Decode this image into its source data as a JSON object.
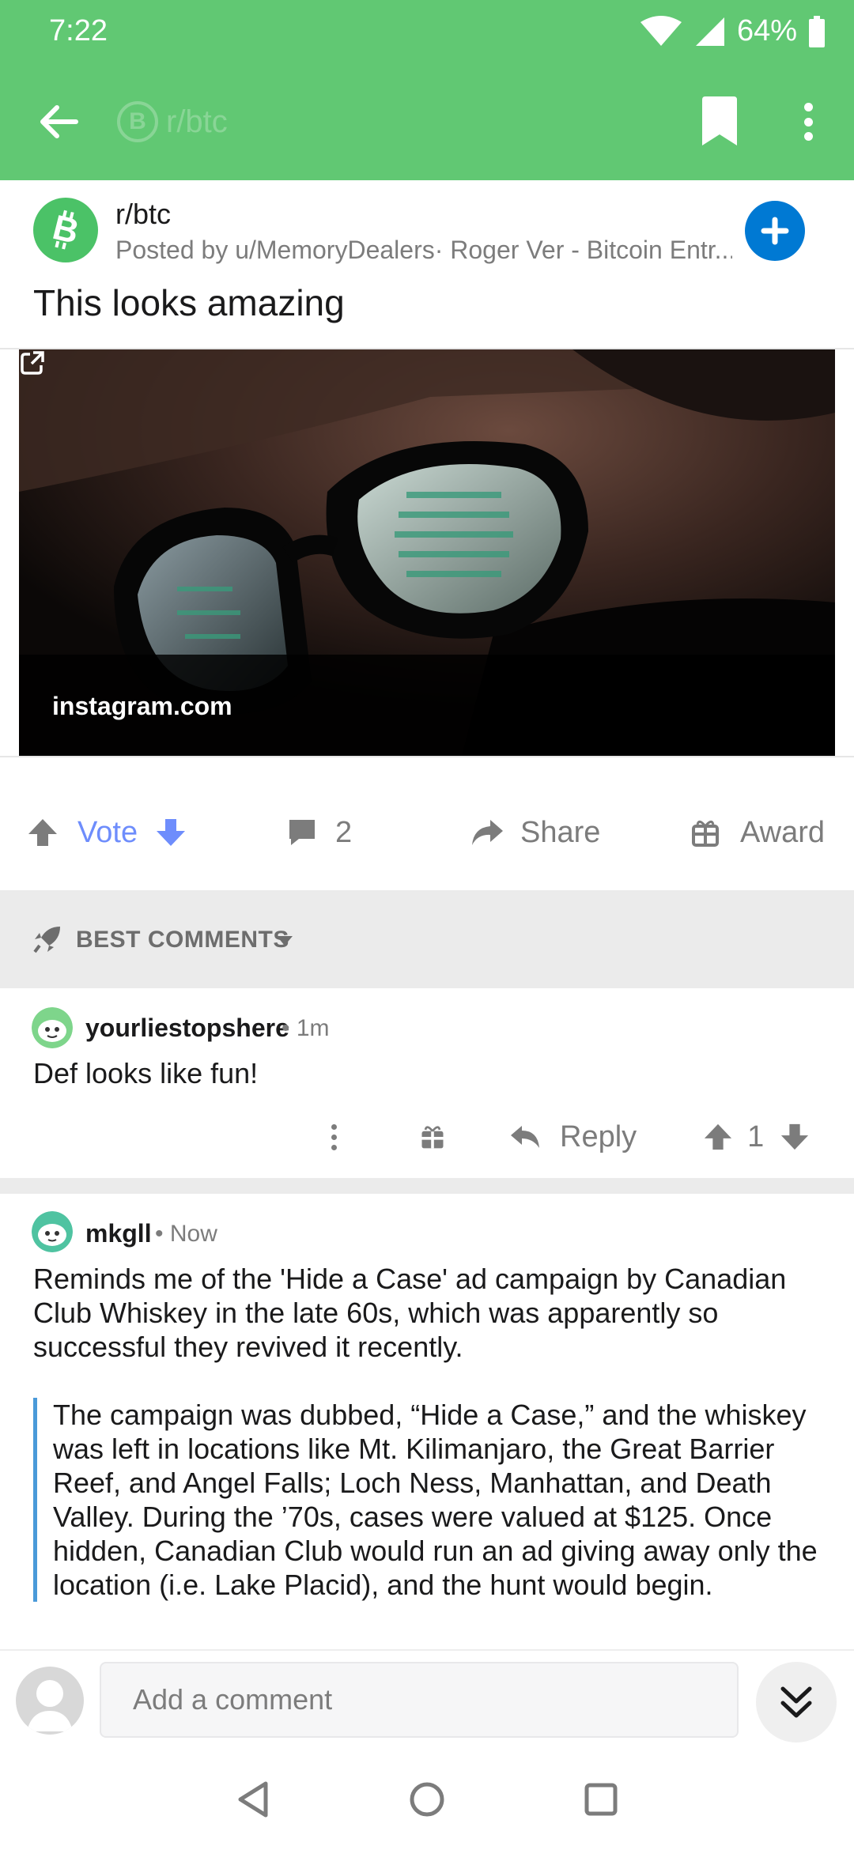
{
  "status": {
    "time": "7:22",
    "battery": "64%"
  },
  "toolbar": {
    "title": "r/btc"
  },
  "post": {
    "subreddit": "r/btc",
    "posted_by": "Posted by u/MemoryDealers· Roger Ver - Bitcoin Entr...",
    "title": "This looks amazing",
    "link_domain": "instagram.com"
  },
  "actions": {
    "vote_label": "Vote",
    "comment_count": "2",
    "share_label": "Share",
    "award_label": "Award"
  },
  "sort": {
    "label": "BEST COMMENTS"
  },
  "comments": [
    {
      "user": "yourliestopshere",
      "time": "• 1m",
      "body": "Def looks like fun!",
      "reply_label": "Reply",
      "score": "1"
    },
    {
      "user": "mkgll",
      "time": "• Now",
      "body": "Reminds me of the 'Hide a Case' ad campaign by Canadian Club Whiskey in the late 60s, which was apparently so successful they revived it recently.",
      "quote": "The campaign was dubbed, “Hide a Case,” and the whiskey was left in locations like Mt. Kilimanjaro, the Great Barrier Reef, and Angel Falls; Loch Ness, Manhattan, and Death Valley. During the ’70s, cases were valued at $125. Once hidden, Canadian Club would run an ad giving away only the location (i.e. Lake Placid), and the hunt would begin."
    }
  ],
  "composer": {
    "placeholder": "Add a comment"
  },
  "colors": {
    "header": "#61c873",
    "subreddit_icon": "#4bc267",
    "join": "#0079d3",
    "vote": "#6e8dfc",
    "quote_bar": "#4a9ad9"
  },
  "icons": [
    "back-arrow-icon",
    "bookmark-icon",
    "more-vert-icon",
    "bitcoin-logo-icon",
    "plus-icon",
    "external-link-icon",
    "upvote-icon",
    "downvote-icon",
    "comment-icon",
    "share-icon",
    "gift-icon",
    "rocket-icon",
    "caret-down-icon",
    "reply-icon",
    "double-chevron-down-icon",
    "nav-back-icon",
    "nav-home-icon",
    "nav-recents-icon"
  ]
}
